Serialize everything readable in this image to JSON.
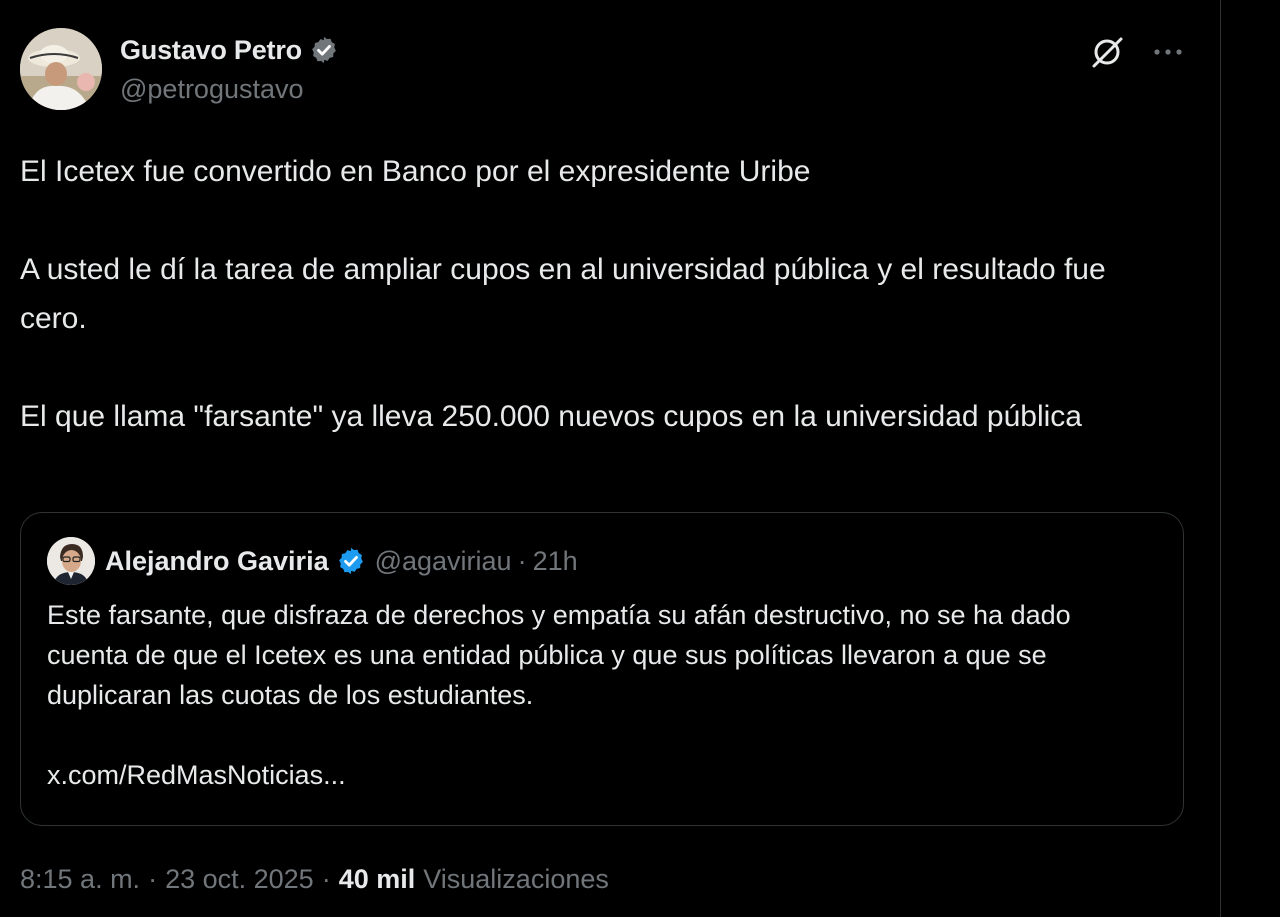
{
  "tweet": {
    "author": {
      "display_name": "Gustavo Petro",
      "handle": "@petrogustavo",
      "verified_icon": "verified-badge-icon"
    },
    "actions": {
      "grok_icon": "grok-icon",
      "more_icon": "more-icon"
    },
    "paragraphs": [
      "El Icetex fue convertido en Banco por el expresidente Uribe",
      "A usted le dí la tarea de ampliar cupos en al universidad pública y el resultado fue cero.",
      "El que llama \"farsante\" ya lleva 250.000 nuevos cupos en la universidad pública"
    ],
    "quote": {
      "display_name": "Alejandro Gaviria",
      "handle": "@agaviriau",
      "separator": "·",
      "time": "21h",
      "text": "Este farsante, que disfraza de derechos y empatía su afán destructivo, no se ha dado cuenta de que el Icetex es una entidad pública y que sus políticas llevaron a que se duplicaran las cuotas de los estudiantes.",
      "link": "x.com/RedMasNoticias..."
    },
    "meta": {
      "time": "8:15 a. m.",
      "separator": "·",
      "date": "23 oct. 2025",
      "views_count": "40 mil",
      "views_label": "Visualizaciones"
    }
  },
  "colors": {
    "background": "#000000",
    "primary_text": "#e7e9ea",
    "secondary_text": "#71767b",
    "border": "#2f3336",
    "verified_blue": "#1d9bf0"
  }
}
